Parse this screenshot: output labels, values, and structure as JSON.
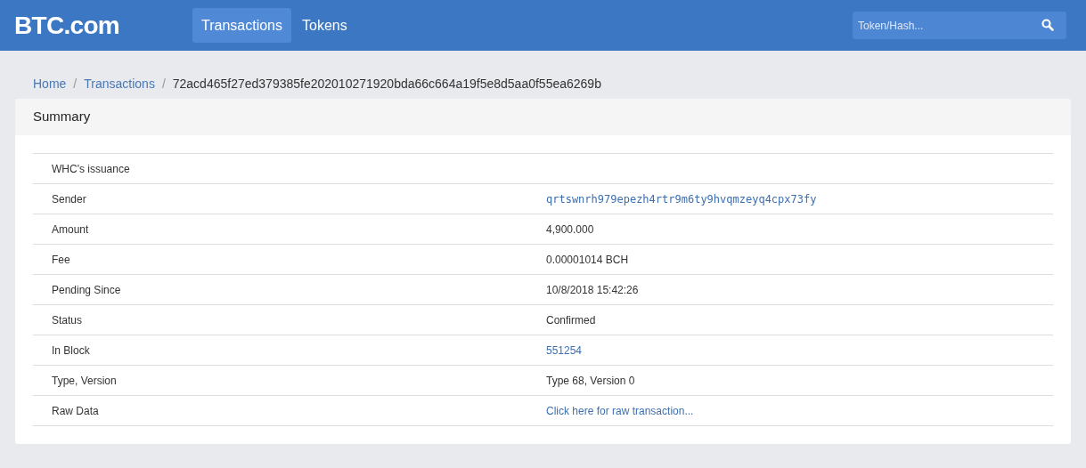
{
  "header": {
    "logo": "BTC.com",
    "nav": [
      {
        "label": "Transactions",
        "selected": true
      },
      {
        "label": "Tokens",
        "selected": false
      }
    ],
    "search": {
      "placeholder": "Token/Hash..."
    }
  },
  "breadcrumb": [
    {
      "label": "Home",
      "kind": "link"
    },
    {
      "label": "/",
      "kind": "separator"
    },
    {
      "label": "Transactions",
      "kind": "link"
    },
    {
      "label": "/",
      "kind": "separator"
    },
    {
      "label": "72acd465f27ed379385fe202010271920bda66c664a19f5e8d5aa0f55ea6269b",
      "kind": "current"
    }
  ],
  "summary": {
    "title": "Summary",
    "rows": [
      {
        "label": "WHC's issuance"
      },
      {
        "label": "Sender",
        "value": "qrtswnrh979epezh4rtr9m6ty9hvqmzeyq4cpx73fy",
        "kind": "mono_link"
      },
      {
        "label": "Amount",
        "value": "4,900.000",
        "kind": "text"
      },
      {
        "label": "Fee",
        "value": "0.00001014 BCH",
        "kind": "text"
      },
      {
        "label": "Pending Since",
        "value": "10/8/2018 15:42:26",
        "kind": "text"
      },
      {
        "label": "Status",
        "value": "Confirmed",
        "kind": "text"
      },
      {
        "label": "In Block",
        "value": "551254",
        "kind": "link"
      },
      {
        "label": "Type, Version",
        "value": "Type 68, Version 0",
        "kind": "text"
      },
      {
        "label": "Raw Data",
        "value": "Click here for raw transaction...",
        "kind": "link"
      }
    ]
  }
}
